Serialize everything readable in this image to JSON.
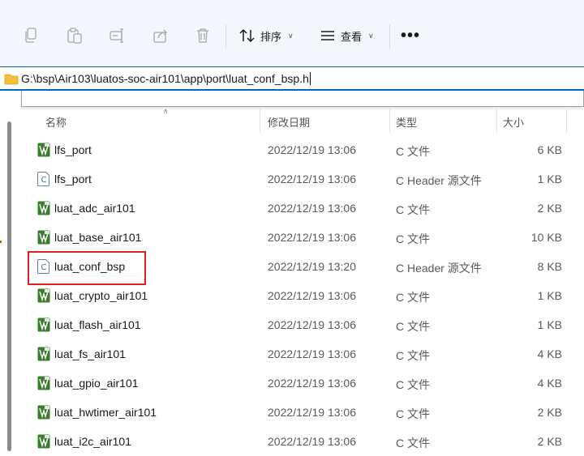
{
  "toolbar": {
    "sort_label": "排序",
    "view_label": "查看",
    "more_label": "•••",
    "icons": [
      "copy-icon",
      "paste-icon",
      "rename-icon",
      "share-icon",
      "delete-icon",
      "sort-icon",
      "view-icon"
    ]
  },
  "address": {
    "path": "G:\\bsp\\Air103\\luatos-soc-air101\\app\\port\\luat_conf_bsp.h"
  },
  "columns": {
    "name": "名称",
    "date": "修改日期",
    "type": "类型",
    "size": "大小"
  },
  "files": [
    {
      "name": "lfs_port",
      "date": "2022/12/19 13:06",
      "type": "C 文件",
      "size": "6 KB",
      "icon": "c-source-file-icon"
    },
    {
      "name": "lfs_port",
      "date": "2022/12/19 13:06",
      "type": "C Header 源文件",
      "size": "1 KB",
      "icon": "c-header-file-icon"
    },
    {
      "name": "luat_adc_air101",
      "date": "2022/12/19 13:06",
      "type": "C 文件",
      "size": "2 KB",
      "icon": "c-source-file-icon"
    },
    {
      "name": "luat_base_air101",
      "date": "2022/12/19 13:06",
      "type": "C 文件",
      "size": "10 KB",
      "icon": "c-source-file-icon"
    },
    {
      "name": "luat_conf_bsp",
      "date": "2022/12/19 13:20",
      "type": "C Header 源文件",
      "size": "8 KB",
      "icon": "c-header-file-icon"
    },
    {
      "name": "luat_crypto_air101",
      "date": "2022/12/19 13:06",
      "type": "C 文件",
      "size": "1 KB",
      "icon": "c-source-file-icon"
    },
    {
      "name": "luat_flash_air101",
      "date": "2022/12/19 13:06",
      "type": "C 文件",
      "size": "1 KB",
      "icon": "c-source-file-icon"
    },
    {
      "name": "luat_fs_air101",
      "date": "2022/12/19 13:06",
      "type": "C 文件",
      "size": "4 KB",
      "icon": "c-source-file-icon"
    },
    {
      "name": "luat_gpio_air101",
      "date": "2022/12/19 13:06",
      "type": "C 文件",
      "size": "4 KB",
      "icon": "c-source-file-icon"
    },
    {
      "name": "luat_hwtimer_air101",
      "date": "2022/12/19 13:06",
      "type": "C 文件",
      "size": "2 KB",
      "icon": "c-source-file-icon"
    },
    {
      "name": "luat_i2c_air101",
      "date": "2022/12/19 13:06",
      "type": "C 文件",
      "size": "2 KB",
      "icon": "c-source-file-icon"
    }
  ],
  "colors": {
    "accent": "#0067c0",
    "highlight": "#e02020",
    "c_file_icon": "#3a7d2c"
  }
}
